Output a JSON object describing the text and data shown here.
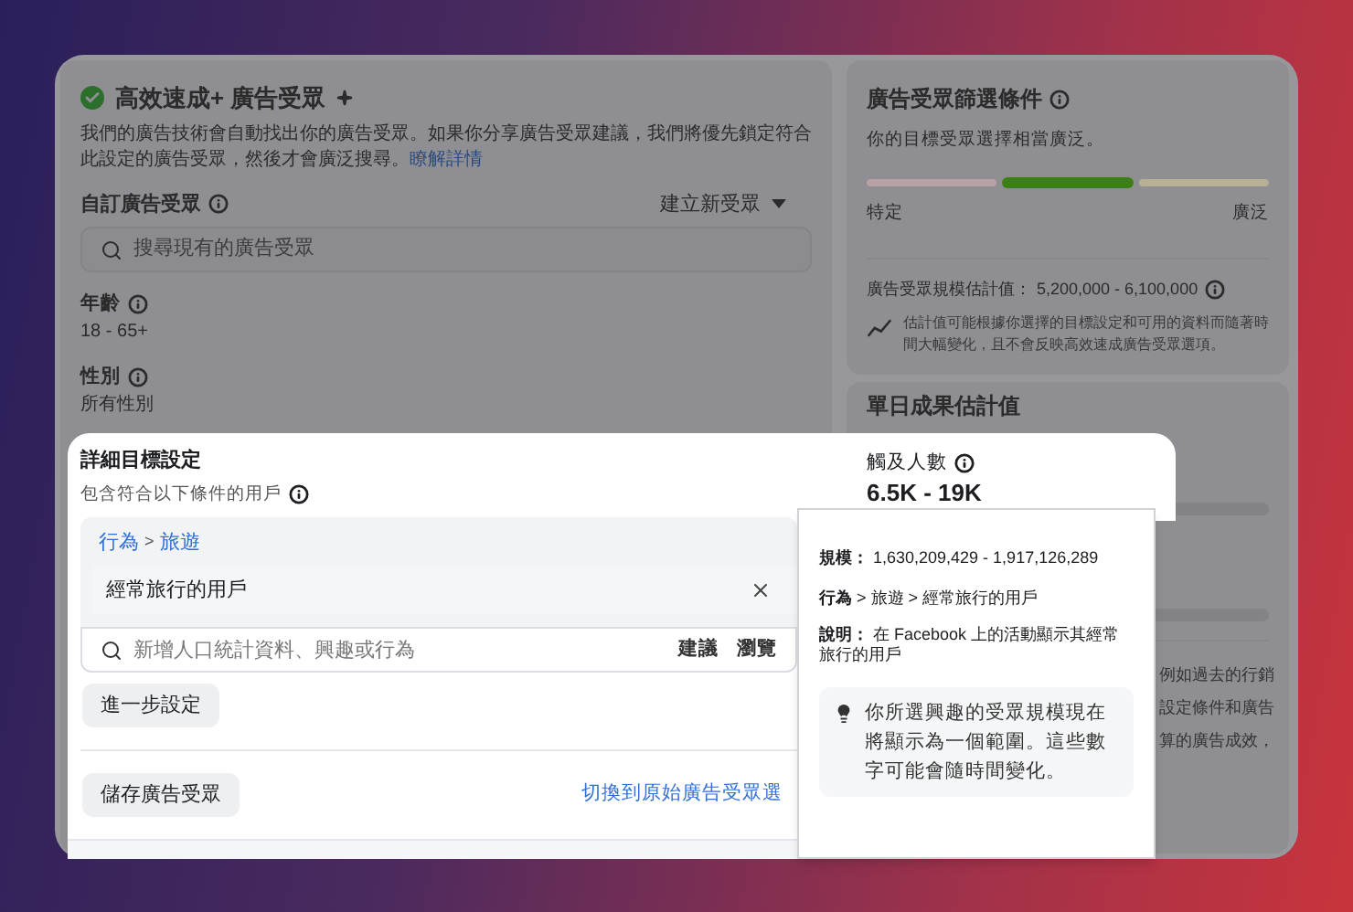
{
  "audience": {
    "title": "高效速成+ 廣告受眾",
    "description": "我們的廣告技術會自動找出你的廣告受眾。如果你分享廣告受眾建議，我們將優先鎖定符合此設定的廣告受眾，然後才會廣泛搜尋。",
    "learn_more": "瞭解詳情",
    "custom_audience_label": "自訂廣告受眾",
    "create_button": "建立新受眾",
    "search_placeholder": "搜尋現有的廣告受眾",
    "age_label": "年齡",
    "age_value": "18 - 65+",
    "gender_label": "性別",
    "gender_value": "所有性別"
  },
  "audience_definition": {
    "title": "廣告受眾篩選條件",
    "summary": "你的目標受眾選擇相當廣泛。",
    "gauge": [
      {
        "color": "#b9a2a6",
        "selected": false
      },
      {
        "color": "#3c7f16",
        "selected": true
      },
      {
        "color": "#b6b095",
        "selected": false
      }
    ],
    "min_label": "特定",
    "max_label": "廣泛",
    "size_label": "廣告受眾規模估計值：",
    "size_value": "5,200,000 - 6,100,000",
    "note": "估計值可能根據你選擇的目標設定和可用的資料而隨著時間大幅變化，且不會反映高效速成廣告受眾選項。"
  },
  "daily_results": {
    "title": "單日成果估計值",
    "reach_label": "觸及人數",
    "reach_value": "6.5K - 19K",
    "partial_lines": [
      "例如過去的行銷",
      "設定條件和廣告",
      "算的廣告成效，"
    ]
  },
  "detailed_targeting": {
    "title": "詳細目標設定",
    "subtitle": "包含符合以下條件的用戶",
    "breadcrumb": [
      "行為",
      "旅遊"
    ],
    "breadcrumb_separator": ">",
    "selected_item": "經常旅行的用戶",
    "search_placeholder": "新增人口統計資料、興趣或行為",
    "search_actions": [
      "建議",
      "瀏覽"
    ],
    "more_button": "進一步設定",
    "save_button": "儲存廣告受眾",
    "switch_link": "切換到原始廣告受眾選"
  },
  "tooltip": {
    "size": "**規模：** 1,630,209,429 - 1,917,126,289",
    "path": "**行為** > 旅遊 > 經常旅行的用戶",
    "description": "**說明：** 在 Facebook 上的活動顯示其經常旅行的用戶",
    "note": "你所選興趣的受眾規模現在將顯示為一個範圍。這些數字可能會隨時間變化。"
  }
}
